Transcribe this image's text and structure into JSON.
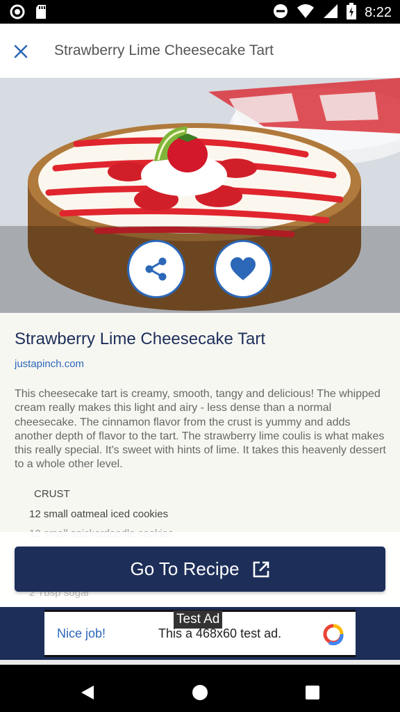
{
  "status_bar": {
    "time": "8:22"
  },
  "app_bar": {
    "title": "Strawberry Lime Cheesecake Tart"
  },
  "recipe": {
    "title": "Strawberry Lime Cheesecake Tart",
    "source": "justapinch.com",
    "description": "This cheesecake tart is creamy, smooth, tangy and delicious! The whipped cream really makes this light and airy - less dense than a normal cheesecake. The cinnamon flavor from the crust is yummy and adds another depth of flavor to the tart. The strawberry lime coulis is what makes this really special. It's sweet with hints of lime. It takes this heavenly dessert to a whole other level.",
    "section": "CRUST",
    "ingredients": [
      "12 small oatmeal iced cookies",
      "12 small snickerdoodle cookies",
      "2 Tbsp sugar"
    ]
  },
  "actions": {
    "go_to_recipe": "Go To Recipe"
  },
  "ad": {
    "tag": "Test Ad",
    "nice": "Nice job!",
    "text": "This a 468x60 test ad."
  },
  "colors": {
    "primary": "#1d2e59",
    "accent": "#2c67b8"
  }
}
